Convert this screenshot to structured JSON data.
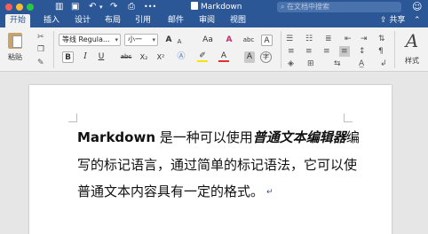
{
  "window": {
    "title": "Markdown",
    "search_placeholder": "在文档中搜索"
  },
  "tabs": [
    {
      "label": "开始",
      "active": true
    },
    {
      "label": "插入"
    },
    {
      "label": "设计"
    },
    {
      "label": "布局"
    },
    {
      "label": "引用"
    },
    {
      "label": "邮件"
    },
    {
      "label": "审阅"
    },
    {
      "label": "视图"
    }
  ],
  "share_label": "共享",
  "ribbon": {
    "paste_label": "粘贴",
    "font_name": "等线 Regula...",
    "font_size": "小一",
    "bold": "B",
    "italic": "I",
    "underline": "U",
    "strike": "abc",
    "subscript": "X₂",
    "superscript": "X²",
    "styles_label": "样式",
    "grow_font": "A",
    "shrink_font": "A",
    "change_case": "Aa",
    "clear_format": "A",
    "phonetic": "abc",
    "char_border": "A",
    "font_color": "A",
    "char_shade": "A",
    "enclose": "字"
  },
  "colors": {
    "accent": "#2b5797",
    "font_color_bar": "#e03030",
    "highlight_bar": "#f5e400"
  },
  "document": {
    "lead_bold": "Markdown",
    "part1": " 是一种可以使用",
    "italic_term": "普通文本编辑器",
    "part2": "编写的标记语言，通过简单的标记语法，它可以使普通文本内容具有一定的格式。",
    "paragraph_mark": "↵"
  }
}
